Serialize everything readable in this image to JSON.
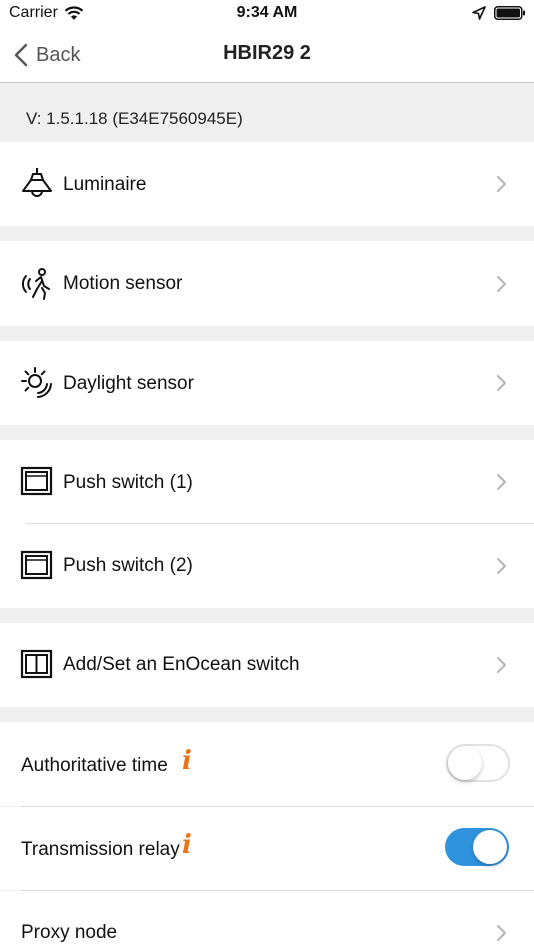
{
  "status_bar": {
    "carrier": "Carrier",
    "time": "9:34 AM"
  },
  "nav": {
    "back_label": "Back",
    "title": "HBIR29 2"
  },
  "version_text": "V: 1.5.1.18  (E34E7560945E)",
  "items": [
    {
      "label": "Luminaire",
      "icon": "ceiling-lamp-icon"
    },
    {
      "label": "Motion sensor",
      "icon": "motion-sensor-icon"
    },
    {
      "label": "Daylight sensor",
      "icon": "daylight-sensor-icon"
    },
    {
      "label": "Push switch (1)",
      "icon": "push-switch-icon"
    },
    {
      "label": "Push switch (2)",
      "icon": "push-switch-icon"
    },
    {
      "label": "Add/Set an EnOcean switch",
      "icon": "double-switch-icon"
    }
  ],
  "settings": [
    {
      "label": "Authoritative time",
      "info": "i",
      "enabled": false
    },
    {
      "label": "Transmission relay",
      "info": "i",
      "enabled": true
    },
    {
      "label": "Proxy node"
    }
  ],
  "colors": {
    "accent_info": "#e8751a",
    "toggle_on": "#2f93dd",
    "group_background": "#efefef"
  }
}
